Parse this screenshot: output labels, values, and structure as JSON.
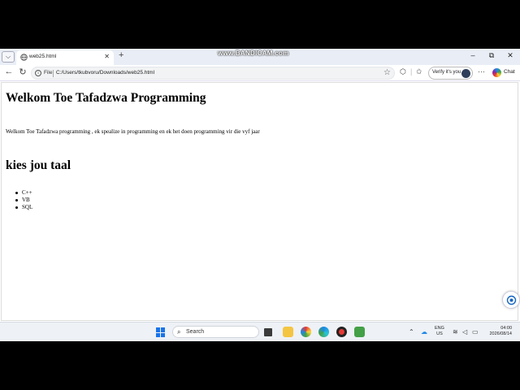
{
  "recorder": {
    "banner": "www.BANDICAM.com"
  },
  "browser": {
    "tab": {
      "title": "web25.html"
    },
    "address": {
      "scheme_label": "File",
      "url": "C:/Users/tkubvoru/Downloads/web25.html"
    },
    "verify_label": "Verify it's you",
    "chat_label": "Chat",
    "window_controls": {
      "minimize": "–",
      "restore": "⧉",
      "close": "✕"
    }
  },
  "page": {
    "heading": "Welkom Toe Tafadzwa Programming",
    "paragraph": "Welkom Toe Tafadzwa programming , ek spealize in programming en ek het doen programming vir die vyf jaar",
    "subheading": "kies jou taal",
    "languages": [
      "C++",
      "VB",
      "SQL"
    ]
  },
  "taskbar": {
    "search_placeholder": "Search",
    "language": {
      "line1": "ENG",
      "line2": "US"
    },
    "clock": {
      "time": "04:00",
      "date": "2026/08/14"
    }
  },
  "colors": {
    "accent": "#1a73e8",
    "tab_strip": "#e9eef6",
    "taskbar": "#eef1f6"
  }
}
